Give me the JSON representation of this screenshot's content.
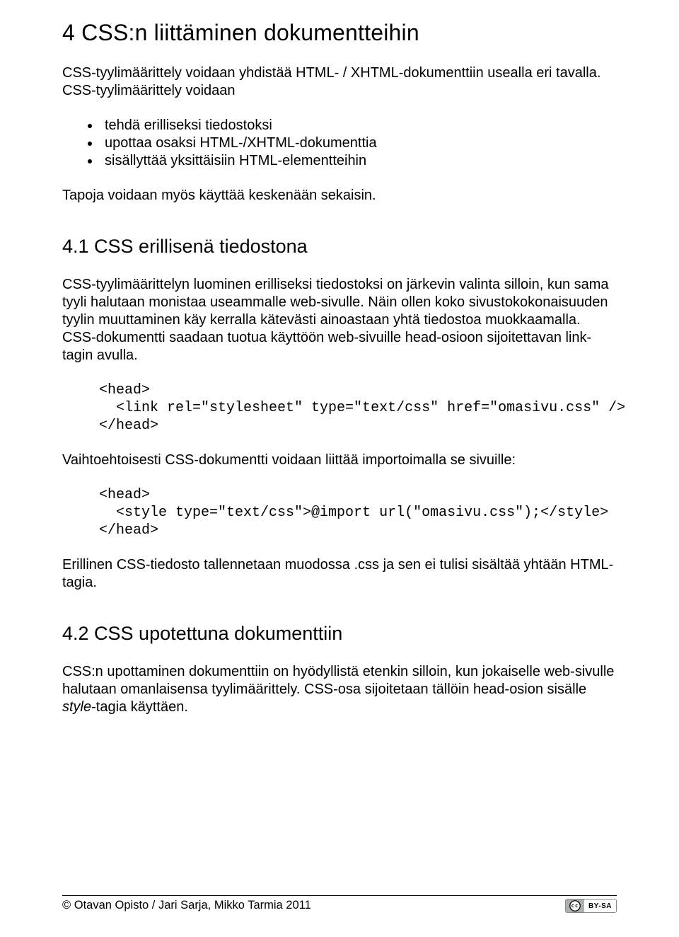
{
  "h1": "4 CSS:n liittäminen dokumentteihin",
  "intro1": "CSS-tyylimäärittely voidaan yhdistää HTML- / XHTML-dokumenttiin usealla eri tavalla. CSS-tyylimäärittely voidaan",
  "bullets": [
    "tehdä erilliseksi tiedostoksi",
    "upottaa osaksi HTML-/XHTML-dokumenttia",
    "sisällyttää yksittäisiin HTML-elementteihin"
  ],
  "intro2": "Tapoja voidaan myös käyttää keskenään sekaisin.",
  "s41": {
    "title": "4.1 CSS erillisenä tiedostona",
    "p1": "CSS-tyylimäärittelyn luominen erilliseksi tiedostoksi on järkevin valinta silloin, kun sama tyyli halutaan monistaa useammalle web-sivulle. Näin ollen koko sivustokokonaisuuden tyylin muuttaminen käy kerralla kätevästi ainoastaan yhtä tiedostoa muokkaamalla. CSS-dokumentti saadaan tuotua käyttöön web-sivuille head-osioon sijoitettavan link-tagin avulla.",
    "code1": "<head>\n  <link rel=\"stylesheet\" type=\"text/css\" href=\"omasivu.css\" />\n</head>",
    "p2": "Vaihtoehtoisesti CSS-dokumentti voidaan liittää importoimalla se sivuille:",
    "code2": "<head>\n  <style type=\"text/css\">@import url(\"omasivu.css\");</style>\n</head>",
    "p3": "Erillinen CSS-tiedosto tallennetaan muodossa .css ja sen ei tulisi sisältää yhtään HTML-tagia."
  },
  "s42": {
    "title": "4.2 CSS upotettuna dokumenttiin",
    "p1_a": "CSS:n upottaminen dokumenttiin on hyödyllistä etenkin silloin, kun jokaiselle web-sivulle halutaan omanlaisensa tyylimäärittely. CSS-osa sijoitetaan tällöin head-osion sisälle ",
    "p1_style": "style",
    "p1_b": "-tagia käyttäen."
  },
  "footer": {
    "copyright": "© Otavan Opisto / Jari Sarja, Mikko Tarmia 2011",
    "cc": "BY-SA"
  }
}
